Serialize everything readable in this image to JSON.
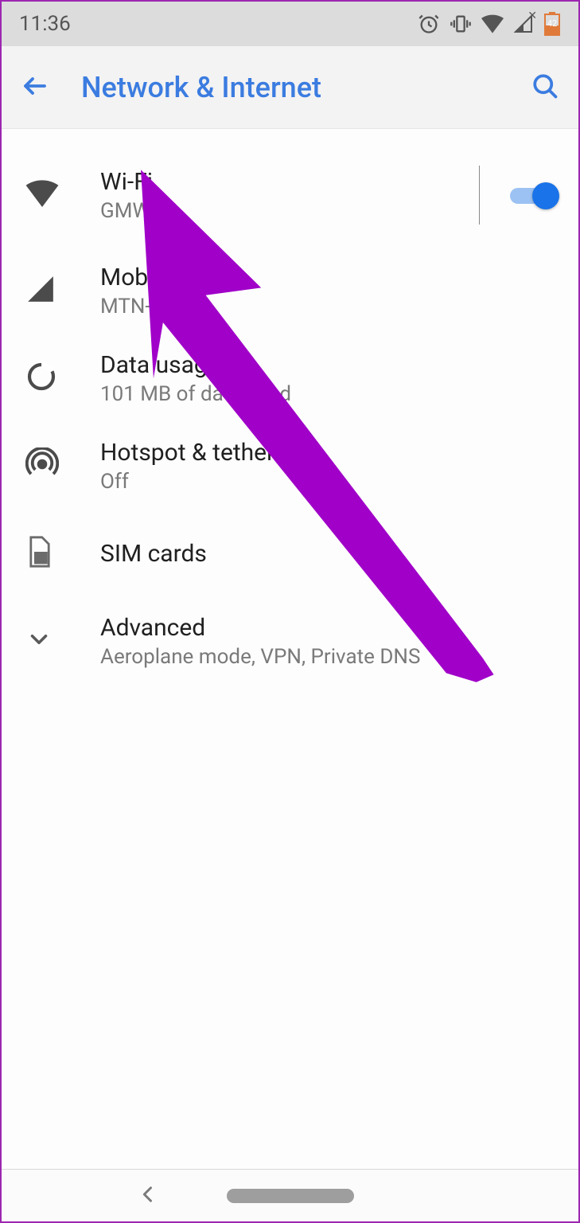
{
  "status": {
    "time": "11:36",
    "battery_level": "42"
  },
  "appbar": {
    "title": "Network & Internet"
  },
  "items": {
    "wifi": {
      "title": "Wi-Fi",
      "subtitle": "GMW",
      "toggle_on": true
    },
    "mobile": {
      "title": "Mobile",
      "subtitle": "MTN-NG"
    },
    "data": {
      "title": "Data usage",
      "subtitle": "101 MB of data used"
    },
    "hotspot": {
      "title": "Hotspot & tethering",
      "subtitle": "Off"
    },
    "sim": {
      "title": "SIM cards"
    },
    "advanced": {
      "title": "Advanced",
      "subtitle": "Aeroplane mode, VPN, Private DNS"
    }
  }
}
